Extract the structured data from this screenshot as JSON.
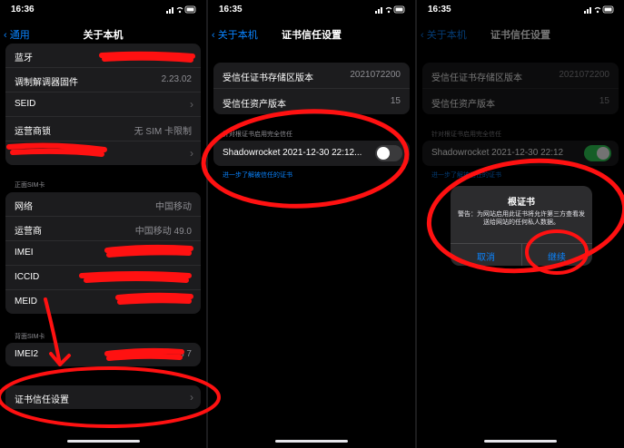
{
  "status": {
    "p1_time": "16:36",
    "p2_time": "16:35",
    "p3_time": "16:35"
  },
  "panel1": {
    "back": "通用",
    "title": "关于本机",
    "rows_top": [
      {
        "label": "蓝牙",
        "value": ""
      },
      {
        "label": "调制解调器固件",
        "value": "2.23.02"
      },
      {
        "label": "SEID",
        "value": ""
      },
      {
        "label": "运营商锁",
        "value": "无 SIM 卡限制"
      },
      {
        "label": "",
        "value": ""
      }
    ],
    "primary_sim_header": "正面SIM卡",
    "rows_primary": [
      {
        "label": "网络",
        "value": "中国移动"
      },
      {
        "label": "运营商",
        "value": "中国移动 49.0"
      },
      {
        "label": "IMEI",
        "value": ""
      },
      {
        "label": "ICCID",
        "value": "8"
      },
      {
        "label": "MEID",
        "value": ""
      }
    ],
    "secondary_sim_header": "背面SIM卡",
    "rows_secondary": [
      {
        "label": "IMEI2",
        "value": "3 7"
      }
    ],
    "cert_settings": "证书信任设置"
  },
  "panel2": {
    "back": "关于本机",
    "title": "证书信任设置",
    "store_version_label": "受信任证书存储区版本",
    "store_version_value": "2021072200",
    "asset_version_label": "受信任资产版本",
    "asset_version_value": "15",
    "full_trust_header": "针对根证书启用完全信任",
    "cert_name": "Shadowrocket 2021-12-30 22:12...",
    "cert_toggle": "off",
    "learn_more": "进一步了解被信任的证书"
  },
  "panel3": {
    "back": "关于本机",
    "title": "证书信任设置",
    "store_version_label": "受信任证书存储区版本",
    "store_version_value": "2021072200",
    "asset_version_label": "受信任资产版本",
    "asset_version_value": "15",
    "full_trust_header": "针对根证书启用完全信任",
    "cert_name": "Shadowrocket 2021-12-30 22:12",
    "cert_toggle": "on",
    "learn_more": "进一步了解被信任的证书",
    "alert": {
      "title": "根证书",
      "message": "警告：为网站启用此证书将允许第三方查看发送给网站的任何私人数据。",
      "cancel": "取消",
      "continue": "继续"
    }
  },
  "colors": {
    "accent": "#0a84ff",
    "switch_on": "#30d158",
    "annotation": "#ff0000"
  }
}
